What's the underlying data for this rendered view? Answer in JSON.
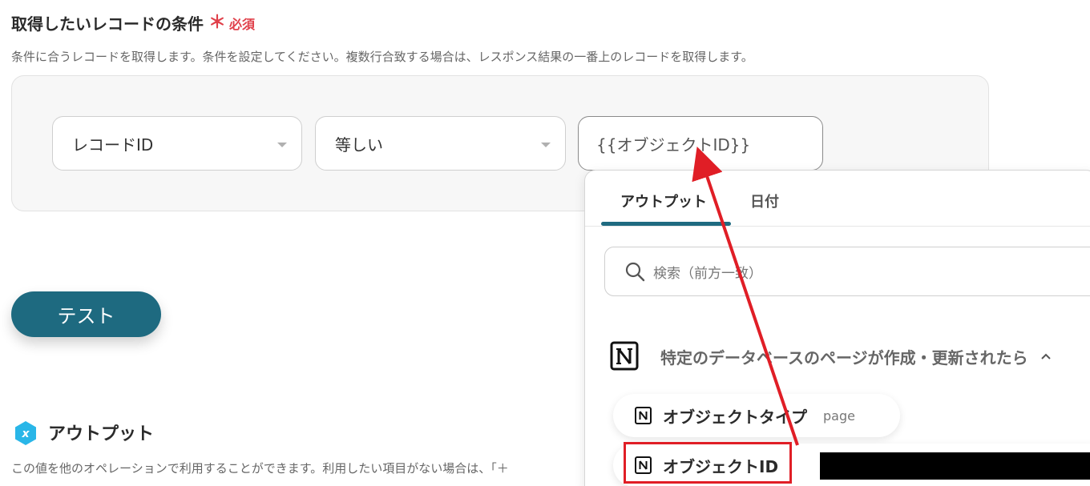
{
  "section": {
    "title": "取得したいレコードの条件",
    "required_mark": "＊",
    "required_label": "必須",
    "description": "条件に合うレコードを取得します。条件を設定してください。複数行合致する場合は、レスポンス結果の一番上のレコードを取得します。"
  },
  "condition": {
    "field": "レコードID",
    "operator": "等しい",
    "value": "{{オブジェクトID}}"
  },
  "test_button": "テスト",
  "output": {
    "title": "アウトプット",
    "description": "この値を他のオペレーションで利用することができます。利用したい項目がない場合は、「＋"
  },
  "panel": {
    "tabs": [
      {
        "label": "アウトプット",
        "active": true
      },
      {
        "label": "日付",
        "active": false
      }
    ],
    "search_placeholder": "検索（前方一致）",
    "trigger_title": "特定のデータベースのページが作成・更新されたら",
    "items": [
      {
        "label": "オブジェクトタイプ",
        "value": "page"
      },
      {
        "label": "オブジェクトID",
        "value": ""
      }
    ]
  },
  "colors": {
    "accent": "#1e6a80",
    "required": "#e0404a",
    "annotation": "#e01e26"
  }
}
